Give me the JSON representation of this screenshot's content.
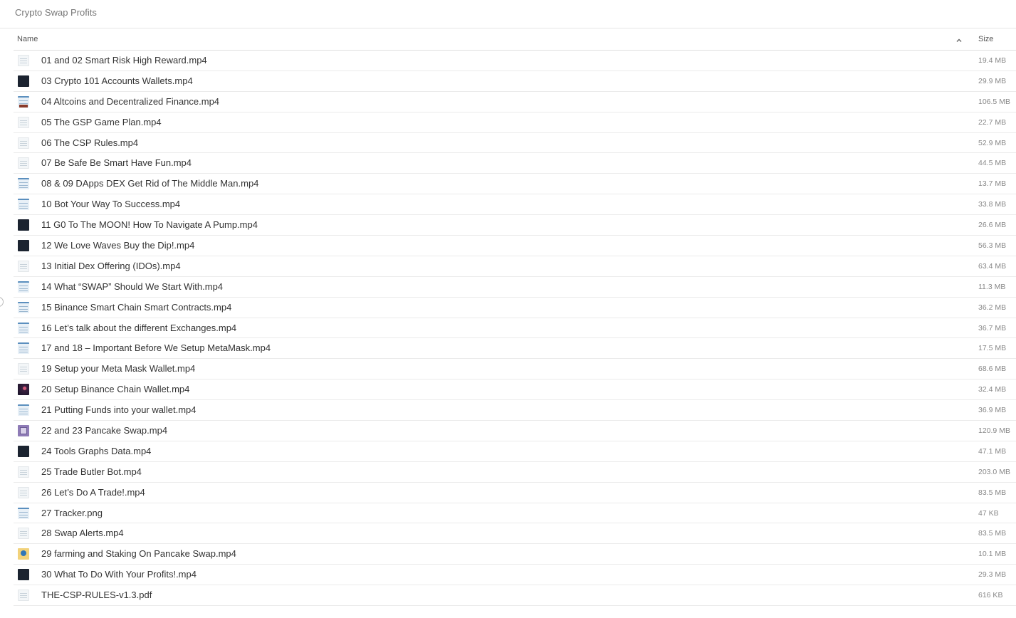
{
  "folder_title": "Crypto Swap Profits",
  "columns": {
    "name": "Name",
    "size": "Size"
  },
  "files": [
    {
      "name": "01 and 02 Smart Risk High Reward.mp4",
      "size": "19.4 MB",
      "thumb": "document-thumbnail"
    },
    {
      "name": "03 Crypto 101 Accounts Wallets.mp4",
      "size": "29.9 MB",
      "thumb": "dark-video-thumbnail"
    },
    {
      "name": "04 Altcoins and Decentralized Finance.mp4",
      "size": "106.5 MB",
      "thumb": "chart-thumbnail"
    },
    {
      "name": "05 The GSP Game Plan.mp4",
      "size": "22.7 MB",
      "thumb": "document-thumbnail"
    },
    {
      "name": "06 The CSP Rules.mp4",
      "size": "52.9 MB",
      "thumb": "document-thumbnail"
    },
    {
      "name": "07 Be Safe Be Smart Have Fun.mp4",
      "size": "44.5 MB",
      "thumb": "document-thumbnail"
    },
    {
      "name": "08 & 09 DApps DEX Get Rid of The Middle Man.mp4",
      "size": "13.7 MB",
      "thumb": "web-thumbnail"
    },
    {
      "name": "10 Bot Your Way To Success.mp4",
      "size": "33.8 MB",
      "thumb": "web-thumbnail"
    },
    {
      "name": "11 G0 To The MOON! How To Navigate A Pump.mp4",
      "size": "26.6 MB",
      "thumb": "dark-video-thumbnail"
    },
    {
      "name": "12 We Love Waves Buy the Dip!.mp4",
      "size": "56.3 MB",
      "thumb": "dark-video-thumbnail"
    },
    {
      "name": "13 Initial Dex Offering (IDOs).mp4",
      "size": "63.4 MB",
      "thumb": "document-thumbnail"
    },
    {
      "name": "14 What “SWAP” Should We Start With.mp4",
      "size": "11.3 MB",
      "thumb": "web-thumbnail"
    },
    {
      "name": "15 Binance Smart Chain Smart Contracts.mp4",
      "size": "36.2 MB",
      "thumb": "web-thumbnail"
    },
    {
      "name": "16 Let’s talk about the different Exchanges.mp4",
      "size": "36.7 MB",
      "thumb": "web-thumbnail"
    },
    {
      "name": "17 and 18 – Important Before We Setup MetaMask.mp4",
      "size": "17.5 MB",
      "thumb": "web-thumbnail"
    },
    {
      "name": "19 Setup your Meta Mask Wallet.mp4",
      "size": "68.6 MB",
      "thumb": "document-thumbnail"
    },
    {
      "name": "20 Setup Binance Chain Wallet.mp4",
      "size": "32.4 MB",
      "thumb": "galaxy-thumbnail"
    },
    {
      "name": "21 Putting Funds into your wallet.mp4",
      "size": "36.9 MB",
      "thumb": "web-thumbnail"
    },
    {
      "name": "22 and 23 Pancake Swap.mp4",
      "size": "120.9 MB",
      "thumb": "purple-thumbnail"
    },
    {
      "name": "24 Tools Graphs Data.mp4",
      "size": "47.1 MB",
      "thumb": "dark-video-thumbnail"
    },
    {
      "name": "25 Trade Butler Bot.mp4",
      "size": "203.0 MB",
      "thumb": "document-thumbnail"
    },
    {
      "name": "26 Let’s Do A Trade!.mp4",
      "size": "83.5 MB",
      "thumb": "document-thumbnail"
    },
    {
      "name": "27 Tracker.png",
      "size": "47 KB",
      "thumb": "web-thumbnail"
    },
    {
      "name": "28 Swap Alerts.mp4",
      "size": "83.5 MB",
      "thumb": "document-thumbnail"
    },
    {
      "name": "29 farming and Staking On Pancake Swap.mp4",
      "size": "10.1 MB",
      "thumb": "coin-thumbnail"
    },
    {
      "name": "30 What To Do With Your Profits!.mp4",
      "size": "29.3 MB",
      "thumb": "dark-video-thumbnail"
    },
    {
      "name": "THE-CSP-RULES-v1.3.pdf",
      "size": "616 KB",
      "thumb": "pdf-thumbnail"
    }
  ]
}
